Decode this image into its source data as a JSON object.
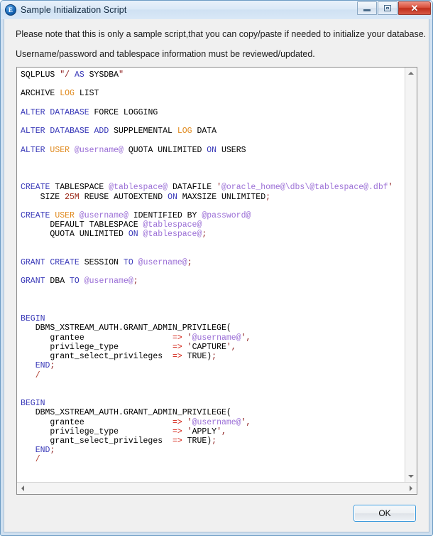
{
  "window": {
    "title": "Sample Initialization Script",
    "icon": "oracle-circle-icon",
    "icon_glyph": "E",
    "controls": {
      "minimize_label": "Minimize",
      "maximize_label": "Restore",
      "close_label": "Close",
      "close_glyph": "✕"
    }
  },
  "notes": {
    "line1": "Please note that this is only a sample script,that you can copy/paste if needed to initialize your database.",
    "line2": "Username/password and tablespace information must be reviewed/updated."
  },
  "footer": {
    "ok_label": "OK"
  },
  "scrollbars": {
    "vertical_up": "▲",
    "vertical_down": "▼",
    "horizontal_left": "◀",
    "horizontal_right": "▶"
  },
  "colors": {
    "keyword_blue": "#3838b8",
    "keyword_orange": "#e08a1e",
    "variable_purple": "#9b6fd6",
    "string_purple": "#9b6fd6",
    "punct_red": "#8b1a1a",
    "number_red": "#9b2a1a",
    "arrow_red": "#d21c0e",
    "plain_black": "#000000",
    "accent_blue": "#3c9adc",
    "titlebar_blue": "#cfe1f3",
    "close_red": "#bf2e1b"
  },
  "script": {
    "plain_text": "SQLPLUS \"/ AS SYSDBA\"\n\nARCHIVE LOG LIST\n\nALTER DATABASE FORCE LOGGING\n\nALTER DATABASE ADD SUPPLEMENTAL LOG DATA\n\nALTER USER @username@ QUOTA UNLIMITED ON USERS\n\n\n\nCREATE TABLESPACE @tablespace@ DATAFILE '@oracle_home@\\dbs\\@tablespace@.dbf'\n    SIZE 25M REUSE AUTOEXTEND ON MAXSIZE UNLIMITED;\n\nCREATE USER @username@ IDENTIFIED BY @password@\n      DEFAULT TABLESPACE @tablespace@\n      QUOTA UNLIMITED ON @tablespace@;\n\n\nGRANT CREATE SESSION TO @username@;\n\nGRANT DBA TO @username@;\n\n\n\nBEGIN\n   DBMS_XSTREAM_AUTH.GRANT_ADMIN_PRIVILEGE(\n      grantee                  => '@username@',\n      privilege_type           => 'CAPTURE',\n      grant_select_privileges  => TRUE);\n   END;\n   /\n\n\nBEGIN\n   DBMS_XSTREAM_AUTH.GRANT_ADMIN_PRIVILEGE(\n      grantee                  => '@username@',\n      privilege_type           => 'APPLY',\n      grant_select_privileges  => TRUE);\n   END;\n   /",
    "tokens": [
      [
        {
          "t": "SQLPLUS ",
          "c": "p"
        },
        {
          "t": "\"/",
          "c": "q"
        },
        {
          "t": " ",
          "c": "p"
        },
        {
          "t": "AS",
          "c": "k"
        },
        {
          "t": " SYSDBA",
          "c": "p"
        },
        {
          "t": "\"",
          "c": "q"
        }
      ],
      [],
      [
        {
          "t": "ARCHIVE ",
          "c": "p"
        },
        {
          "t": "LOG",
          "c": "k2"
        },
        {
          "t": " LIST",
          "c": "p"
        }
      ],
      [],
      [
        {
          "t": "ALTER DATABASE",
          "c": "k"
        },
        {
          "t": " FORCE LOGGING",
          "c": "p"
        }
      ],
      [],
      [
        {
          "t": "ALTER DATABASE ADD",
          "c": "k"
        },
        {
          "t": " SUPPLEMENTAL ",
          "c": "p"
        },
        {
          "t": "LOG",
          "c": "k2"
        },
        {
          "t": " DATA",
          "c": "p"
        }
      ],
      [],
      [
        {
          "t": "ALTER ",
          "c": "k"
        },
        {
          "t": "USER",
          "c": "k2"
        },
        {
          "t": " ",
          "c": "p"
        },
        {
          "t": "@username@",
          "c": "var"
        },
        {
          "t": " QUOTA UNLIMITED ",
          "c": "p"
        },
        {
          "t": "ON",
          "c": "k"
        },
        {
          "t": " USERS",
          "c": "p"
        }
      ],
      [],
      [],
      [],
      [
        {
          "t": "CREATE",
          "c": "k"
        },
        {
          "t": " TABLESPACE ",
          "c": "p"
        },
        {
          "t": "@tablespace@",
          "c": "var"
        },
        {
          "t": " DATAFILE ",
          "c": "p"
        },
        {
          "t": "'",
          "c": "q"
        },
        {
          "t": "@oracle_home@\\dbs\\@tablespace@.dbf",
          "c": "str"
        },
        {
          "t": "'",
          "c": "q"
        }
      ],
      [
        {
          "t": "    SIZE ",
          "c": "p"
        },
        {
          "t": "25M",
          "c": "num"
        },
        {
          "t": " REUSE AUTOEXTEND ",
          "c": "p"
        },
        {
          "t": "ON",
          "c": "k"
        },
        {
          "t": " MAXSIZE UNLIMITED",
          "c": "p"
        },
        {
          "t": ";",
          "c": "q"
        }
      ],
      [],
      [
        {
          "t": "CREATE ",
          "c": "k"
        },
        {
          "t": "USER",
          "c": "k2"
        },
        {
          "t": " ",
          "c": "p"
        },
        {
          "t": "@username@",
          "c": "var"
        },
        {
          "t": " IDENTIFIED BY ",
          "c": "p"
        },
        {
          "t": "@password@",
          "c": "var"
        }
      ],
      [
        {
          "t": "      DEFAULT TABLESPACE ",
          "c": "p"
        },
        {
          "t": "@tablespace@",
          "c": "var"
        }
      ],
      [
        {
          "t": "      QUOTA UNLIMITED ",
          "c": "p"
        },
        {
          "t": "ON",
          "c": "k"
        },
        {
          "t": " ",
          "c": "p"
        },
        {
          "t": "@tablespace@",
          "c": "var"
        },
        {
          "t": ";",
          "c": "q"
        }
      ],
      [],
      [],
      [
        {
          "t": "GRANT CREATE",
          "c": "k"
        },
        {
          "t": " SESSION ",
          "c": "p"
        },
        {
          "t": "TO",
          "c": "k"
        },
        {
          "t": " ",
          "c": "p"
        },
        {
          "t": "@username@",
          "c": "var"
        },
        {
          "t": ";",
          "c": "q"
        }
      ],
      [],
      [
        {
          "t": "GRANT",
          "c": "k"
        },
        {
          "t": " DBA ",
          "c": "p"
        },
        {
          "t": "TO",
          "c": "k"
        },
        {
          "t": " ",
          "c": "p"
        },
        {
          "t": "@username@",
          "c": "var"
        },
        {
          "t": ";",
          "c": "q"
        }
      ],
      [],
      [],
      [],
      [
        {
          "t": "BEGIN",
          "c": "k"
        }
      ],
      [
        {
          "t": "   DBMS_XSTREAM_AUTH.GRANT_ADMIN_PRIVILEGE(",
          "c": "p"
        }
      ],
      [
        {
          "t": "      grantee                  ",
          "c": "p"
        },
        {
          "t": "=>",
          "c": "arw"
        },
        {
          "t": " ",
          "c": "p"
        },
        {
          "t": "'",
          "c": "q"
        },
        {
          "t": "@username@",
          "c": "var"
        },
        {
          "t": "',",
          "c": "q"
        }
      ],
      [
        {
          "t": "      privilege_type           ",
          "c": "p"
        },
        {
          "t": "=>",
          "c": "arw"
        },
        {
          "t": " ",
          "c": "p"
        },
        {
          "t": "'",
          "c": "q"
        },
        {
          "t": "CAPTURE",
          "c": "p"
        },
        {
          "t": "',",
          "c": "q"
        }
      ],
      [
        {
          "t": "      grant_select_privileges  ",
          "c": "p"
        },
        {
          "t": "=>",
          "c": "arw"
        },
        {
          "t": " TRUE)",
          "c": "p"
        },
        {
          "t": ";",
          "c": "q"
        }
      ],
      [
        {
          "t": "   ",
          "c": "p"
        },
        {
          "t": "END",
          "c": "k"
        },
        {
          "t": ";",
          "c": "q"
        }
      ],
      [
        {
          "t": "   ",
          "c": "p"
        },
        {
          "t": "/",
          "c": "sl"
        }
      ],
      [],
      [],
      [
        {
          "t": "BEGIN",
          "c": "k"
        }
      ],
      [
        {
          "t": "   DBMS_XSTREAM_AUTH.GRANT_ADMIN_PRIVILEGE(",
          "c": "p"
        }
      ],
      [
        {
          "t": "      grantee                  ",
          "c": "p"
        },
        {
          "t": "=>",
          "c": "arw"
        },
        {
          "t": " ",
          "c": "p"
        },
        {
          "t": "'",
          "c": "q"
        },
        {
          "t": "@username@",
          "c": "var"
        },
        {
          "t": "',",
          "c": "q"
        }
      ],
      [
        {
          "t": "      privilege_type           ",
          "c": "p"
        },
        {
          "t": "=>",
          "c": "arw"
        },
        {
          "t": " ",
          "c": "p"
        },
        {
          "t": "'",
          "c": "q"
        },
        {
          "t": "APPLY",
          "c": "p"
        },
        {
          "t": "',",
          "c": "q"
        }
      ],
      [
        {
          "t": "      grant_select_privileges  ",
          "c": "p"
        },
        {
          "t": "=>",
          "c": "arw"
        },
        {
          "t": " TRUE)",
          "c": "p"
        },
        {
          "t": ";",
          "c": "q"
        }
      ],
      [
        {
          "t": "   ",
          "c": "p"
        },
        {
          "t": "END",
          "c": "k"
        },
        {
          "t": ";",
          "c": "q"
        }
      ],
      [
        {
          "t": "   ",
          "c": "p"
        },
        {
          "t": "/",
          "c": "sl"
        }
      ]
    ]
  }
}
